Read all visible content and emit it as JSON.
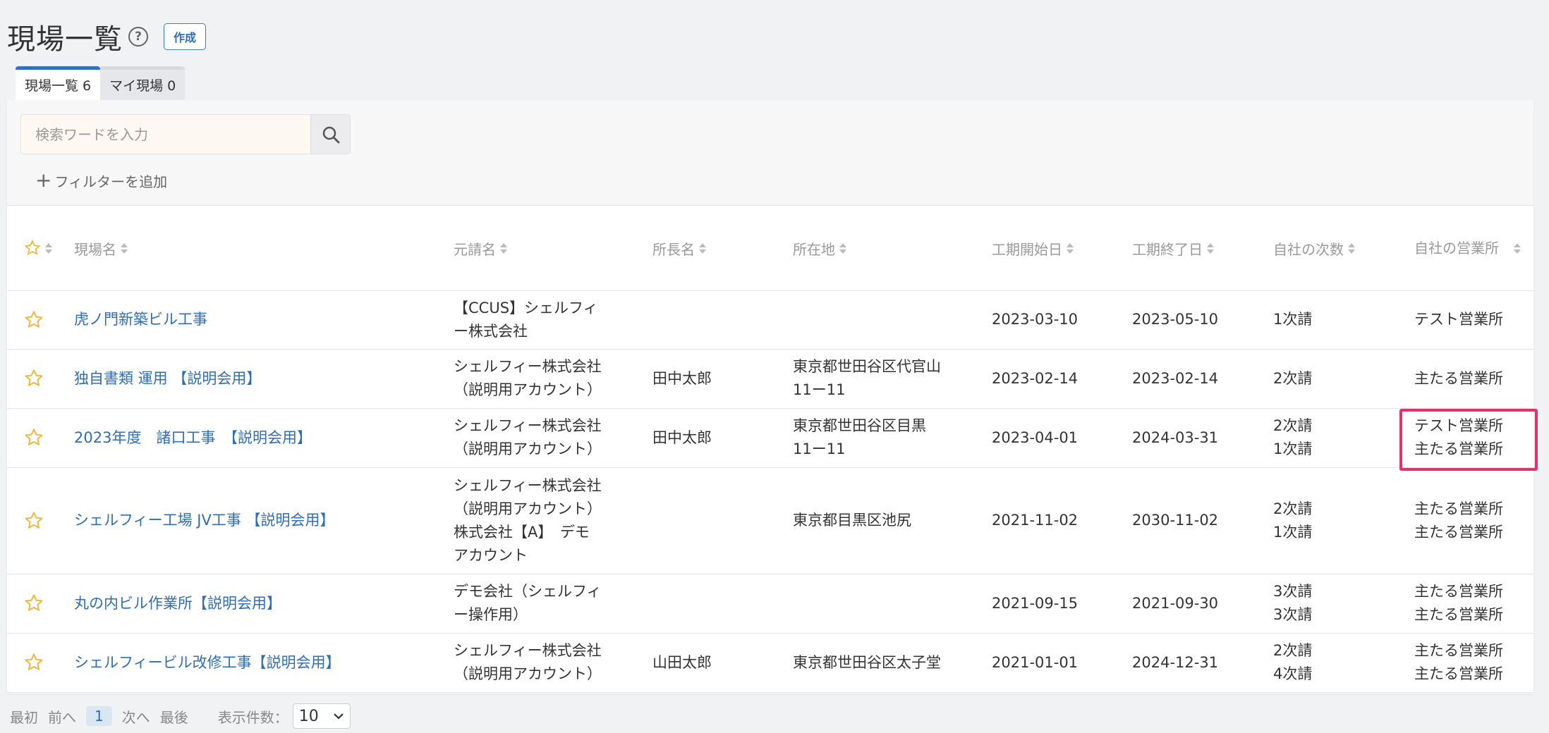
{
  "header": {
    "title": "現場一覧",
    "help_icon": "question-circle-icon",
    "create_label": "作成"
  },
  "tabs": [
    {
      "label": "現場一覧 6",
      "active": true
    },
    {
      "label": "マイ現場 0",
      "active": false
    }
  ],
  "search": {
    "placeholder": "検索ワードを入力",
    "value": "",
    "icon": "search-icon"
  },
  "filter": {
    "add_label": "フィルターを追加"
  },
  "table": {
    "columns": [
      "現場名",
      "元請名",
      "所長名",
      "所在地",
      "工期開始日",
      "工期終了日",
      "自社の次数",
      "自社の営業所"
    ],
    "rows": [
      {
        "name": "虎ノ門新築ビル工事",
        "contractor": [
          "【CCUS】シェルフィ",
          "ー株式会社"
        ],
        "manager": "",
        "location": [],
        "start": "2023-03-10",
        "end": "2023-05-10",
        "tier": [
          "1次請"
        ],
        "office": [
          "テスト営業所"
        ]
      },
      {
        "name": "独自書類 運用 【説明会用】",
        "contractor": [
          "シェルフィー株式会社",
          "（説明用アカウント）"
        ],
        "manager": "田中太郎",
        "location": [
          "東京都世田谷区代官山",
          "11ー11"
        ],
        "start": "2023-02-14",
        "end": "2023-02-14",
        "tier": [
          "2次請"
        ],
        "office": [
          "主たる営業所"
        ]
      },
      {
        "name": "2023年度　諸口工事　【説明会用】",
        "contractor": [
          "シェルフィー株式会社",
          "（説明用アカウント）"
        ],
        "manager": "田中太郎",
        "location": [
          "東京都世田谷区目黒",
          "11ー11"
        ],
        "start": "2023-04-01",
        "end": "2024-03-31",
        "tier": [
          "2次請",
          "1次請"
        ],
        "office": [
          "テスト営業所",
          "主たる営業所"
        ]
      },
      {
        "name": "シェルフィー工場 JV工事 【説明会用】",
        "contractor": [
          "シェルフィー株式会社",
          "（説明用アカウント）",
          "株式会社【A】　デモ",
          "アカウント"
        ],
        "manager": "",
        "location": [
          "東京都目黒区池尻"
        ],
        "start": "2021-11-02",
        "end": "2030-11-02",
        "tier": [
          "2次請",
          "1次請"
        ],
        "office": [
          "主たる営業所",
          "主たる営業所"
        ]
      },
      {
        "name": "丸の内ビル作業所【説明会用】",
        "contractor": [
          "デモ会社（シェルフィ",
          "ー操作用）"
        ],
        "manager": "",
        "location": [],
        "start": "2021-09-15",
        "end": "2021-09-30",
        "tier": [
          "3次請",
          "3次請"
        ],
        "office": [
          "主たる営業所",
          "主たる営業所"
        ]
      },
      {
        "name": "シェルフィービル改修工事【説明会用】",
        "contractor": [
          "シェルフィー株式会社",
          "（説明用アカウント）"
        ],
        "manager": "山田太郎",
        "location": [
          "東京都世田谷区太子堂"
        ],
        "start": "2021-01-01",
        "end": "2024-12-31",
        "tier": [
          "2次請",
          "4次請"
        ],
        "office": [
          "主たる営業所",
          "主たる営業所"
        ]
      }
    ]
  },
  "pagination": {
    "first": "最初",
    "prev": "前へ",
    "current": "1",
    "next": "次へ",
    "last": "最後",
    "per_page_label": "表示件数：",
    "per_page_value": "10"
  },
  "colors": {
    "link": "#2f6db5",
    "star": "#f0b73e",
    "highlight": "#e0336b",
    "tab_active": "#2f72c4"
  }
}
